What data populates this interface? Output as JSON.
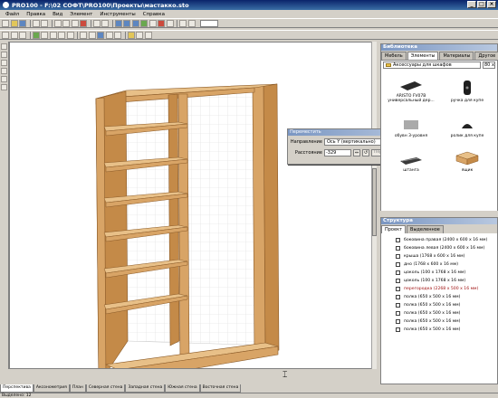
{
  "window": {
    "title": "PRO100 - F:\\02 СОФТ\\PRO100\\Проекты\\мастакко.sto",
    "buttons": [
      "_",
      "□",
      "×"
    ]
  },
  "menu": [
    "Файл",
    "Правка",
    "Вид",
    "Элемент",
    "Инструменты",
    "Справка"
  ],
  "view_tabs": [
    "Перспектива",
    "Аксонометрия",
    "План",
    "Северная стена",
    "Западная стена",
    "Южная стена",
    "Восточная стена"
  ],
  "status_text": "Выделено: 12",
  "move_dialog": {
    "title": "Переместить",
    "direction_label": "Направление",
    "direction_value": "Ось Y (вертикально)",
    "distance_label": "Расстояние",
    "distance_value": "-329",
    "apply_label": "Переместить"
  },
  "library": {
    "title": "Библиотека",
    "tabs": [
      "Мебель",
      "Элементы",
      "Материалы",
      "Другое"
    ],
    "folder": "Аксессуары для шкафов",
    "size": "80 x",
    "items": [
      {
        "label": "ARISTO FV07B универсальный дер...",
        "icon": "tray-icon"
      },
      {
        "label": "ручка для купе",
        "icon": "handle-icon"
      },
      {
        "label": "обувн 3-уровня",
        "icon": "shoe-rack-icon"
      },
      {
        "label": "ролик для купе",
        "icon": "roller-icon"
      },
      {
        "label": "штанга",
        "icon": "rod-icon"
      },
      {
        "label": "ящик",
        "icon": "drawer-icon"
      }
    ]
  },
  "structure": {
    "title": "Структура",
    "tabs": [
      "Проект",
      "Выделенное"
    ],
    "items": [
      {
        "label": "боковина правая  (2400 x 600 x 16 мм)",
        "highlight": false
      },
      {
        "label": "боковина левая  (2400 x 600 x 16 мм)",
        "highlight": false
      },
      {
        "label": "крыша  (1768 x 600 x 16 мм)",
        "highlight": false
      },
      {
        "label": "дно  (1768 x 600 x 16 мм)",
        "highlight": false
      },
      {
        "label": "цоколь  (100 x 1768 x 16 мм)",
        "highlight": false
      },
      {
        "label": "цоколь  (100 x 1768 x 16 мм)",
        "highlight": false
      },
      {
        "label": "перегородка  (2268 x 500 x 16 мм)",
        "highlight": true
      },
      {
        "label": "полка  (650 x 500 x 16 мм)",
        "highlight": false
      },
      {
        "label": "полка  (650 x 500 x 16 мм)",
        "highlight": false
      },
      {
        "label": "полка  (650 x 500 x 16 мм)",
        "highlight": false
      },
      {
        "label": "полка  (650 x 500 x 16 мм)",
        "highlight": false
      },
      {
        "label": "полка  (650 x 500 x 16 мм)",
        "highlight": false
      }
    ]
  },
  "colors": {
    "wood_front": "#d8a466",
    "wood_side": "#c48a48",
    "wood_top": "#e8c088",
    "grid": "#dcdcdc"
  }
}
